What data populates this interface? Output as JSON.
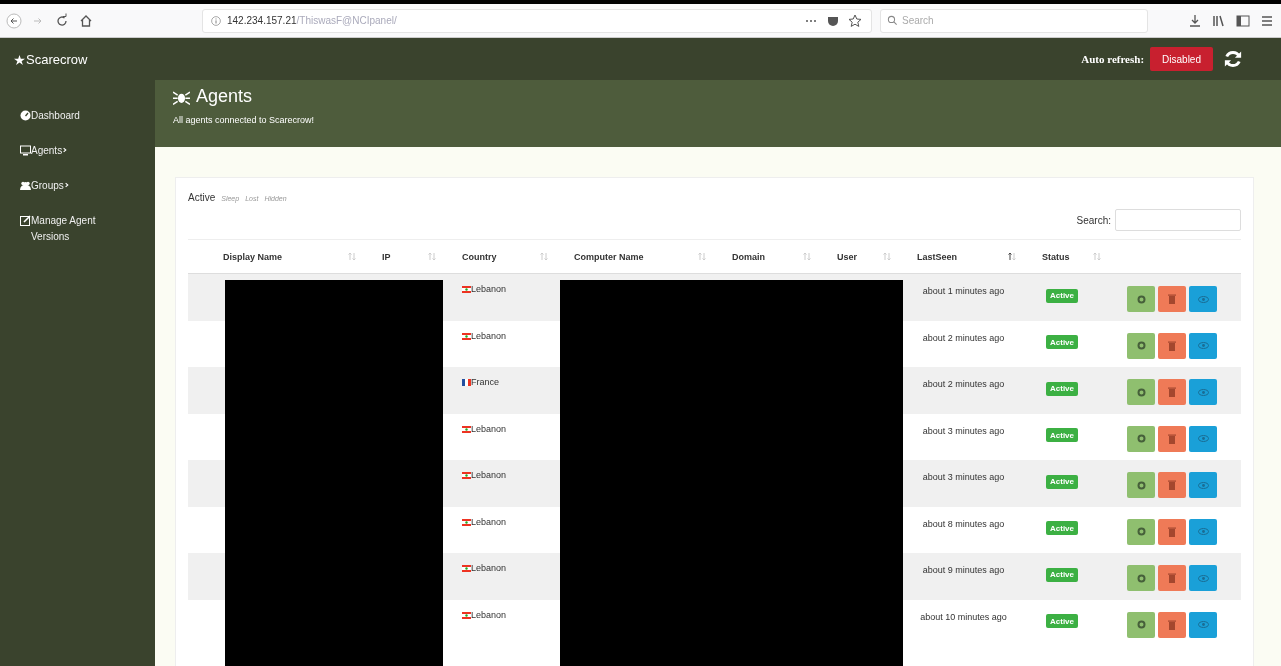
{
  "browser": {
    "url_host": "142.234.157.21",
    "url_path": "/ThiswasF@NCIpanel/",
    "search_placeholder": "Search"
  },
  "app": {
    "brand": "Scarecrow",
    "auto_refresh_label": "Auto refresh:",
    "auto_refresh_button": "Disabled"
  },
  "sidebar": {
    "items": [
      {
        "label": "Dashboard",
        "has_submenu": false
      },
      {
        "label": "Agents",
        "has_submenu": true
      },
      {
        "label": "Groups",
        "has_submenu": true
      },
      {
        "label": "Manage Agent Versions",
        "has_submenu": false
      }
    ]
  },
  "page_header": {
    "title": "Agents",
    "subtitle": "All agents connected to Scarecrow!"
  },
  "tabs": [
    {
      "label": "Active",
      "selected": true
    },
    {
      "label": "Sleep",
      "selected": false
    },
    {
      "label": "Lost",
      "selected": false
    },
    {
      "label": "Hidden",
      "selected": false
    }
  ],
  "search": {
    "label": "Search:"
  },
  "table": {
    "columns": [
      {
        "label": "Display Name",
        "sorted": false
      },
      {
        "label": "IP",
        "sorted": false
      },
      {
        "label": "Country",
        "sorted": false
      },
      {
        "label": "Computer Name",
        "sorted": false
      },
      {
        "label": "Domain",
        "sorted": false
      },
      {
        "label": "User",
        "sorted": false
      },
      {
        "label": "LastSeen",
        "sorted": true
      },
      {
        "label": "Status",
        "sorted": false
      }
    ],
    "rows": [
      {
        "kind": "lb",
        "country": "Lebanon",
        "last_seen": "about 1 minutes ago",
        "status": "Active"
      },
      {
        "kind": "lb",
        "country": "Lebanon",
        "last_seen": "about 2 minutes ago",
        "status": "Active"
      },
      {
        "kind": "fr",
        "country": "France",
        "last_seen": "about 2 minutes ago",
        "status": "Active"
      },
      {
        "kind": "lb",
        "country": "Lebanon",
        "last_seen": "about 3 minutes ago",
        "status": "Active"
      },
      {
        "kind": "lb",
        "country": "Lebanon",
        "last_seen": "about 3 minutes ago",
        "status": "Active"
      },
      {
        "kind": "lb",
        "country": "Lebanon",
        "last_seen": "about 8 minutes ago",
        "status": "Active"
      },
      {
        "kind": "lb",
        "country": "Lebanon",
        "last_seen": "about 9 minutes ago",
        "status": "Active"
      },
      {
        "kind": "lb",
        "country": "Lebanon",
        "last_seen": "about 10 minutes ago",
        "status": "Active"
      }
    ]
  }
}
